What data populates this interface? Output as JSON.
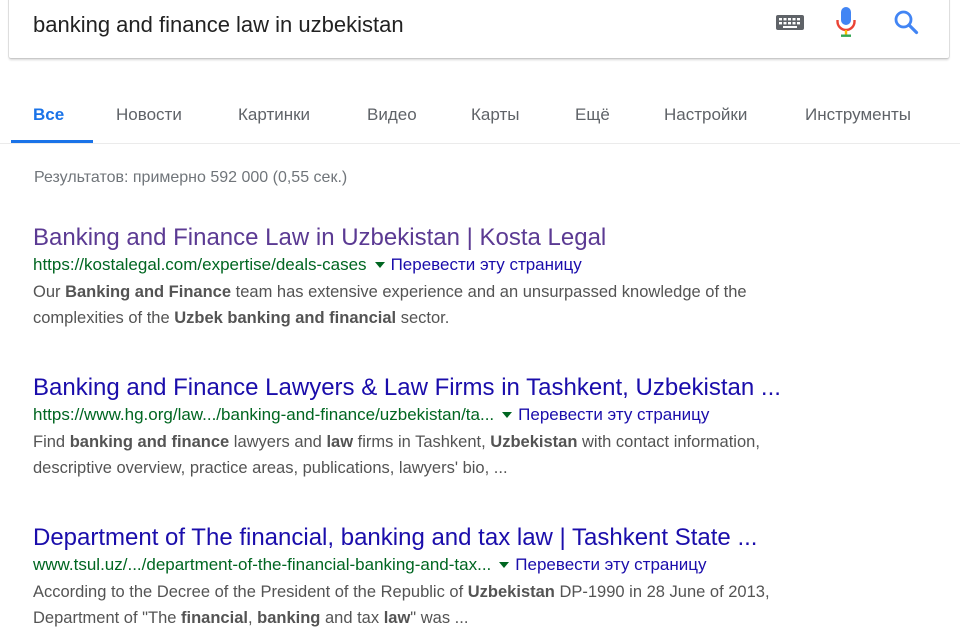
{
  "search": {
    "query": "banking and finance law in uzbekistan"
  },
  "icons": {
    "keyboard": "keyboard-icon",
    "mic": "microphone-icon",
    "search": "search-icon"
  },
  "colors": {
    "accent": "#1a73e8",
    "link": "#1a0dab",
    "visited_link": "#5b3a93",
    "url_green": "#006621",
    "snippet": "#545454"
  },
  "tabs": [
    {
      "label": "Все",
      "active": true
    },
    {
      "label": "Новости"
    },
    {
      "label": "Картинки"
    },
    {
      "label": "Видео"
    },
    {
      "label": "Карты"
    },
    {
      "label": "Ещё"
    },
    {
      "label": "Настройки"
    },
    {
      "label": "Инструменты"
    }
  ],
  "stats": "Результатов: примерно 592 000 (0,55 сек.)",
  "results": [
    {
      "title": "Banking and Finance Law in Uzbekistan | Kosta Legal",
      "visited": true,
      "url": "https://kostalegal.com/expertise/deals-cases",
      "translate": "Перевести эту страницу",
      "snippet_line1": [
        {
          "t": "Our "
        },
        {
          "t": "Banking and Finance",
          "b": true
        },
        {
          "t": " team has extensive experience and an unsurpassed knowledge of the"
        }
      ],
      "snippet_line2": [
        {
          "t": "complexities of the "
        },
        {
          "t": "Uzbek banking and financial",
          "b": true
        },
        {
          "t": " sector."
        }
      ]
    },
    {
      "title": "Banking and Finance Lawyers & Law Firms in Tashkent, Uzbekistan ...",
      "visited": false,
      "url": "https://www.hg.org/law.../banking-and-finance/uzbekistan/ta...",
      "translate": "Перевести эту страницу",
      "snippet_line1": [
        {
          "t": "Find "
        },
        {
          "t": "banking and finance",
          "b": true
        },
        {
          "t": " lawyers and "
        },
        {
          "t": "law",
          "b": true
        },
        {
          "t": " firms in Tashkent, "
        },
        {
          "t": "Uzbekistan",
          "b": true
        },
        {
          "t": " with contact information,"
        }
      ],
      "snippet_line2": [
        {
          "t": "descriptive overview, practice areas, publications, lawyers' bio, ..."
        }
      ]
    },
    {
      "title": "Department of The financial, banking and tax law | Tashkent State ...",
      "visited": false,
      "url": "www.tsul.uz/.../department-of-the-financial-banking-and-tax...",
      "translate": "Перевести эту страницу",
      "snippet_line1": [
        {
          "t": "According to the Decree of the President of the Republic of "
        },
        {
          "t": "Uzbekistan",
          "b": true
        },
        {
          "t": " DP-1990 in 28 June of 2013,"
        }
      ],
      "snippet_line2": [
        {
          "t": "Department of \"The "
        },
        {
          "t": "financial",
          "b": true
        },
        {
          "t": ", "
        },
        {
          "t": "banking",
          "b": true
        },
        {
          "t": " and tax "
        },
        {
          "t": "law",
          "b": true
        },
        {
          "t": "\" was ..."
        }
      ]
    }
  ]
}
